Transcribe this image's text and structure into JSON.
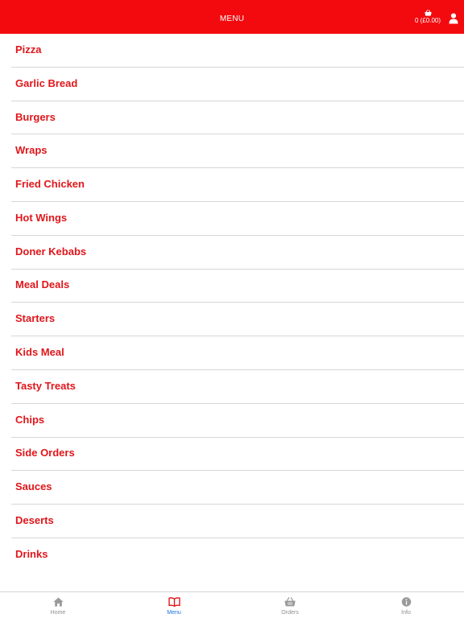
{
  "header": {
    "title": "MENU",
    "basket_text": "0 (£0.00)",
    "basket_icon": "basket-icon",
    "user_icon": "user-icon"
  },
  "menu": {
    "items": [
      {
        "label": "Pizza"
      },
      {
        "label": "Garlic Bread"
      },
      {
        "label": "Burgers"
      },
      {
        "label": "Wraps"
      },
      {
        "label": "Fried Chicken"
      },
      {
        "label": "Hot Wings"
      },
      {
        "label": "Doner Kebabs"
      },
      {
        "label": "Meal Deals"
      },
      {
        "label": "Starters"
      },
      {
        "label": "Kids Meal"
      },
      {
        "label": "Tasty Treats"
      },
      {
        "label": "Chips"
      },
      {
        "label": "Side Orders"
      },
      {
        "label": "Sauces"
      },
      {
        "label": "Deserts"
      },
      {
        "label": "Drinks"
      }
    ]
  },
  "tabbar": {
    "tabs": [
      {
        "label": "Home",
        "icon": "home-icon"
      },
      {
        "label": "Menu",
        "icon": "book-icon",
        "active": true
      },
      {
        "label": "Orders",
        "icon": "basket-icon"
      },
      {
        "label": "Info",
        "icon": "info-icon"
      }
    ]
  },
  "colors": {
    "header_bg": "#f20a0f",
    "item_text": "#e0161b",
    "tab_active": "#1a73e8",
    "tab_inactive": "#8e8e8e"
  }
}
